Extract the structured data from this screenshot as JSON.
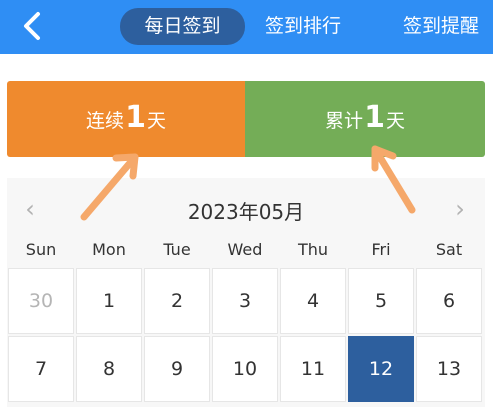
{
  "header": {
    "tabs": [
      {
        "label": "每日签到",
        "active": true
      },
      {
        "label": "签到排行",
        "active": false
      },
      {
        "label": "签到提醒",
        "active": false
      }
    ],
    "bg_color": "#2f8ef4",
    "active_tab_color": "#2d5f9e"
  },
  "stats": {
    "streak": {
      "label": "连续",
      "value": "1",
      "unit": "天",
      "color": "#ef8a2e"
    },
    "total": {
      "label": "累计",
      "value": "1",
      "unit": "天",
      "color": "#74ad57"
    },
    "arrow_color": "#f5a86a"
  },
  "calendar": {
    "month_title": "2023年05月",
    "prev_icon": "chevron-left-icon",
    "next_icon": "chevron-right-icon",
    "weekdays": [
      "Sun",
      "Mon",
      "Tue",
      "Wed",
      "Thu",
      "Fri",
      "Sat"
    ],
    "rows": [
      [
        "30",
        "1",
        "2",
        "3",
        "4",
        "5",
        "6"
      ],
      [
        "7",
        "8",
        "9",
        "10",
        "11",
        "12",
        "13"
      ]
    ],
    "muted_days": [
      "30"
    ],
    "selected_day": "12",
    "selected_color": "#2d5f9e"
  }
}
